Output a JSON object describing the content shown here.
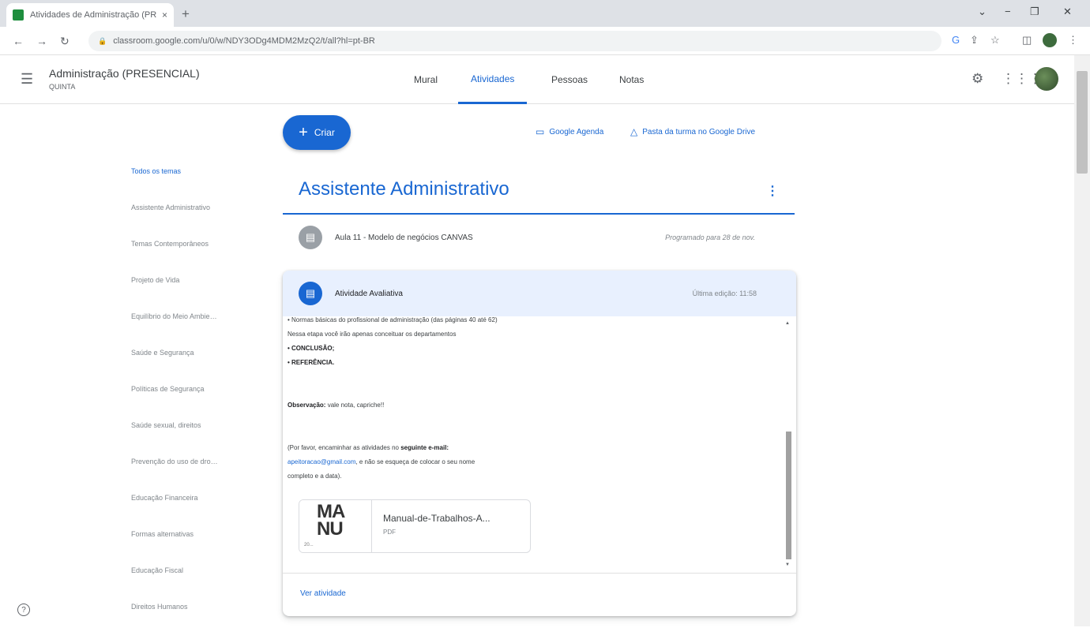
{
  "browser": {
    "tab_title": "Atividades de Administração (PR",
    "tab_close": "×",
    "new_tab": "+",
    "url": "classroom.google.com/u/0/w/NDY3ODg4MDM2MzQ2/t/all?hl=pt-BR",
    "window_controls": [
      "⌄",
      "−",
      "❐",
      "✕"
    ]
  },
  "app": {
    "class_name": "Administração (PRESENCIAL)",
    "class_section": "QUINTA",
    "tabs": [
      {
        "label": "Mural",
        "active": false
      },
      {
        "label": "Atividades",
        "active": true
      },
      {
        "label": "Pessoas",
        "active": false
      },
      {
        "label": "Notas",
        "active": false
      }
    ]
  },
  "actions": {
    "create_label": "Criar",
    "calendar_label": "Google Agenda",
    "drive_label": "Pasta da turma no Google Drive"
  },
  "topics": [
    "Todos os temas",
    "Assistente Administrativo",
    "Temas Contemporâneos",
    "Projeto de Vida",
    "Equilíbrio do Meio Ambiente",
    "Saúde e Segurança",
    "Políticas de Segurança",
    "Saúde sexual, direitos",
    "Prevenção do uso de drogas",
    "Educação Financeira",
    "Formas alternativas",
    "Educação Fiscal",
    "Direitos Humanos"
  ],
  "topic_section": {
    "title": "Assistente Administrativo",
    "items": [
      {
        "title": "Aula 11 - Modelo de negócios CANVAS",
        "status": "Programado para 28 de nov."
      }
    ]
  },
  "card": {
    "title": "Atividade Avaliativa",
    "status": "Última edição: 11:58",
    "lines": {
      "l1": "• Normas básicas do profissional de administração (das páginas 40 até 62)",
      "l2": "Nessa etapa você irão apenas conceituar os departamentos",
      "l3": "• CONCLUSÃO;",
      "l4": "• REFERÊNCIA.",
      "obs_label": "Observação:",
      "obs_text": " vale nota, capriche!!",
      "p1": "(Por favor, encaminhar as atividades no ",
      "p1_bold": "seguinte e-mail:",
      "email": "apeitoracao@gmail.com",
      "p2": ", e não se esqueça de colocar o seu nome",
      "p3": "completo e a data)."
    },
    "attachment": {
      "name": "Manual-de-Trabalhos-A...",
      "type": "PDF",
      "thumb_text": "MA NU",
      "thumb_small": "20..."
    },
    "view_link": "Ver atividade"
  },
  "icons": {
    "hamburger": "menu-icon",
    "settings": "gear-icon",
    "apps": "apps-grid-icon",
    "help": "help-icon"
  },
  "colors": {
    "accent": "#1967d2",
    "card_header": "#e8f0fe",
    "muted": "#80868b"
  }
}
